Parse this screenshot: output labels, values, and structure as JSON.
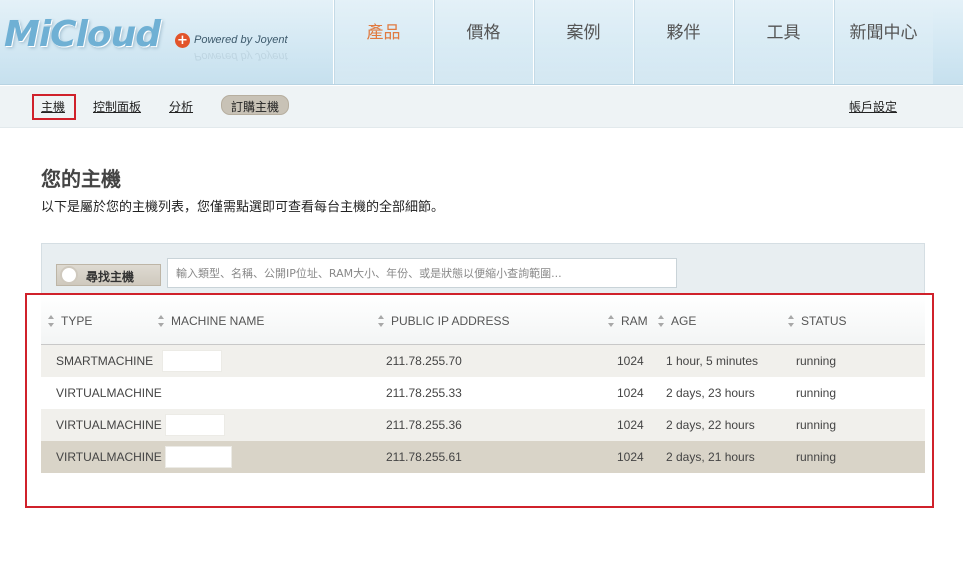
{
  "brand": {
    "logo_text": "MiCloud",
    "powered_by": "Powered by Joyent",
    "accent_plus_color": "#e2542a"
  },
  "top_nav": {
    "items": [
      {
        "label": "產品",
        "active": true
      },
      {
        "label": "價格",
        "active": false
      },
      {
        "label": "案例",
        "active": false
      },
      {
        "label": "夥伴",
        "active": false
      },
      {
        "label": "工具",
        "active": false
      },
      {
        "label": "新聞中心",
        "active": false
      }
    ],
    "active_color": "#e07a40"
  },
  "sub_nav": {
    "host": "主機",
    "control_panel": "控制面板",
    "analysis": "分析",
    "order_host": "訂購主機",
    "account_settings": "帳戶設定"
  },
  "page": {
    "title": "您的主機",
    "subtitle": "以下是屬於您的主機列表，您僅需點選即可查看每台主機的全部細節。"
  },
  "search": {
    "label": "尋找主機",
    "placeholder": "輸入類型、名稱、公開IP位址、RAM大小、年份、或是狀態以便縮小查詢範圍...",
    "value": ""
  },
  "table": {
    "columns": {
      "type": "TYPE",
      "machine_name": "MACHINE NAME",
      "public_ip": "PUBLIC IP ADDRESS",
      "ram": "RAM",
      "age": "AGE",
      "status": "STATUS"
    },
    "rows": [
      {
        "type": "SMARTMACHINE",
        "machine_name": "",
        "public_ip": "211.78.255.70",
        "ram": "1024",
        "age": "1 hour, 5 minutes",
        "status": "running"
      },
      {
        "type": "VIRTUALMACHINE",
        "machine_name": "",
        "public_ip": "211.78.255.33",
        "ram": "1024",
        "age": "2 days, 23 hours",
        "status": "running"
      },
      {
        "type": "VIRTUALMACHINE",
        "machine_name": "",
        "public_ip": "211.78.255.36",
        "ram": "1024",
        "age": "2 days, 22 hours",
        "status": "running"
      },
      {
        "type": "VIRTUALMACHINE",
        "machine_name": "",
        "public_ip": "211.78.255.61",
        "ram": "1024",
        "age": "2 days, 21 hours",
        "status": "running"
      }
    ],
    "selected_row_index": 3,
    "highlight_color": "#d0212b"
  }
}
